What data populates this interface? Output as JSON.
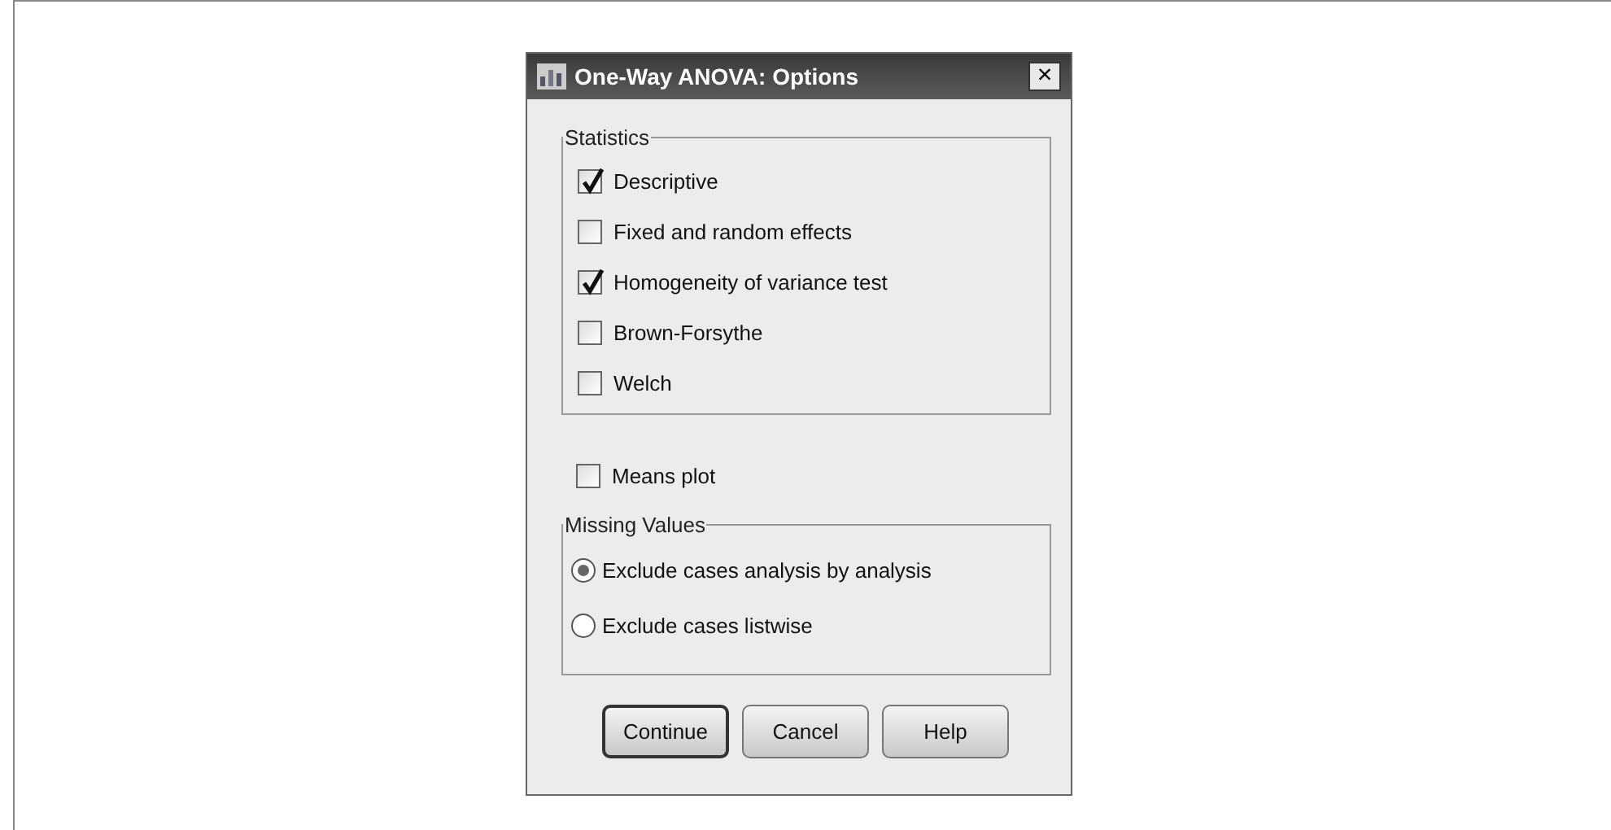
{
  "window": {
    "title": "One-Way ANOVA: Options",
    "close": "×"
  },
  "statistics": {
    "title": "Statistics",
    "options": [
      {
        "label": "Descriptive",
        "checked": true
      },
      {
        "label": "Fixed and random effects",
        "checked": false
      },
      {
        "label": "Homogeneity of variance test",
        "checked": true
      },
      {
        "label": "Brown-Forsythe",
        "checked": false
      },
      {
        "label": "Welch",
        "checked": false
      }
    ]
  },
  "means_plot": {
    "label": "Means plot",
    "checked": false
  },
  "missing_values": {
    "title": "Missing Values",
    "options": [
      {
        "label": "Exclude cases analysis by analysis",
        "selected": true
      },
      {
        "label": "Exclude cases listwise",
        "selected": false
      }
    ]
  },
  "buttons": [
    {
      "label": "Continue",
      "default": true
    },
    {
      "label": "Cancel",
      "default": false
    },
    {
      "label": "Help",
      "default": false
    }
  ]
}
